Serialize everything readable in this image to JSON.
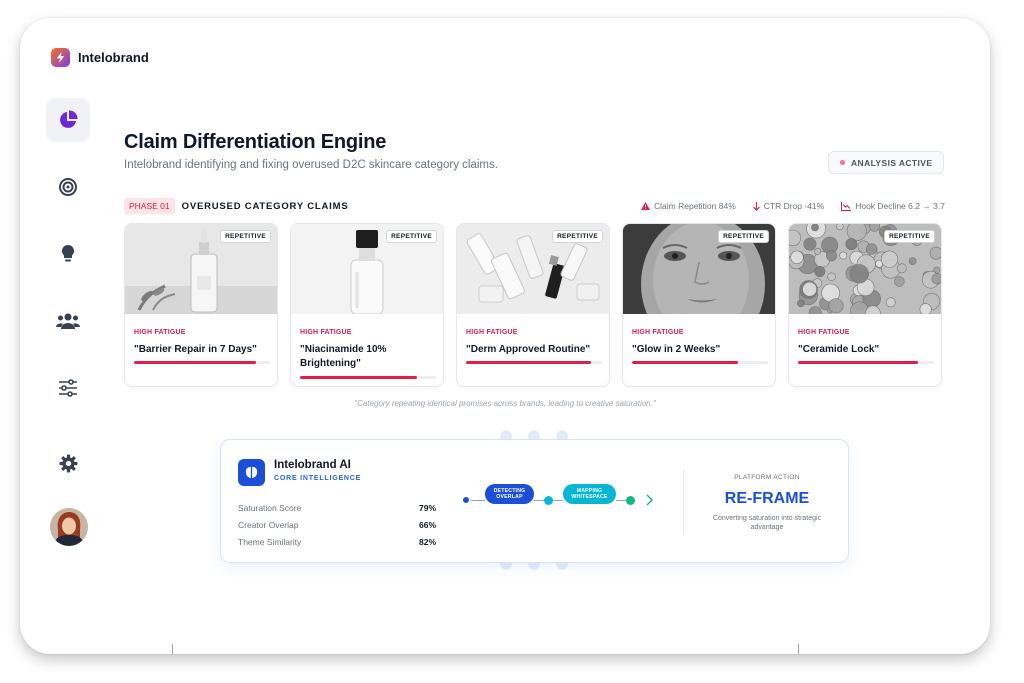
{
  "brand": {
    "name": "Intelobrand"
  },
  "sidebar": {
    "items": [
      {
        "name": "sidebar-item-analytics",
        "icon": "pie-chart-icon",
        "active": true
      },
      {
        "name": "sidebar-item-targets",
        "icon": "target-icon",
        "active": false
      },
      {
        "name": "sidebar-item-ideas",
        "icon": "lightbulb-icon",
        "active": false
      },
      {
        "name": "sidebar-item-creators",
        "icon": "users-icon",
        "active": false
      },
      {
        "name": "sidebar-item-filters",
        "icon": "sliders-icon",
        "active": false
      },
      {
        "name": "sidebar-item-settings",
        "icon": "gear-icon",
        "active": false
      }
    ]
  },
  "header": {
    "title": "Claim Differentiation Engine",
    "subtitle": "Intelobrand identifying and fixing overused D2C skincare category claims.",
    "status": "ANALYSIS ACTIVE"
  },
  "phase": {
    "badge": "PHASE 01",
    "label": "OVERUSED CATEGORY CLAIMS"
  },
  "metrics": [
    {
      "icon": "warning-icon",
      "color": "#e11d48",
      "text": "Claim Repetition 84%"
    },
    {
      "icon": "arrow-down-icon",
      "color": "#e11d48",
      "text": "CTR Drop -41%"
    },
    {
      "icon": "trend-down-icon",
      "color": "#e11d48",
      "text": "Hook Decline 6.2 → 3.7"
    }
  ],
  "cards": [
    {
      "tag": "REPETITIVE",
      "fatigue": "HIGH FATIGUE",
      "claim": "\"Barrier Repair in 7 Days\"",
      "level": 0.9
    },
    {
      "tag": "REPETITIVE",
      "fatigue": "HIGH FATIGUE",
      "claim": "\"Niacinamide 10% Brightening\"",
      "level": 0.86
    },
    {
      "tag": "REPETITIVE",
      "fatigue": "HIGH FATIGUE",
      "claim": "\"Derm Approved Routine\"",
      "level": 0.92
    },
    {
      "tag": "REPETITIVE",
      "fatigue": "HIGH FATIGUE",
      "claim": "\"Glow in 2 Weeks\"",
      "level": 0.78
    },
    {
      "tag": "REPETITIVE",
      "fatigue": "HIGH FATIGUE",
      "claim": "\"Ceramide Lock\"",
      "level": 0.88
    }
  ],
  "caption": "\"Category repeating identical promises across brands, leading to creative saturation.\"",
  "ai": {
    "title": "Intelobrand AI",
    "subtitle": "CORE INTELLIGENCE",
    "scores": [
      {
        "label": "Saturation Score",
        "value": "79%"
      },
      {
        "label": "Creator Overlap",
        "value": "66%"
      },
      {
        "label": "Theme Similarity",
        "value": "82%"
      }
    ],
    "pipeline": [
      {
        "label_line1": "DETECTING",
        "label_line2": "OVERLAP",
        "color": "#1d4ed8"
      },
      {
        "label_line1": "MAPPING",
        "label_line2": "WHITESPACE",
        "color": "#06b6d4"
      }
    ],
    "action_label": "PLATFORM ACTION",
    "action_title": "RE-FRAME",
    "action_desc": "Converting saturation into strategic advantage"
  },
  "colors": {
    "accent": "#e11d48",
    "primary": "#1d4ed8",
    "cyan": "#06b6d4",
    "green": "#10b981"
  }
}
